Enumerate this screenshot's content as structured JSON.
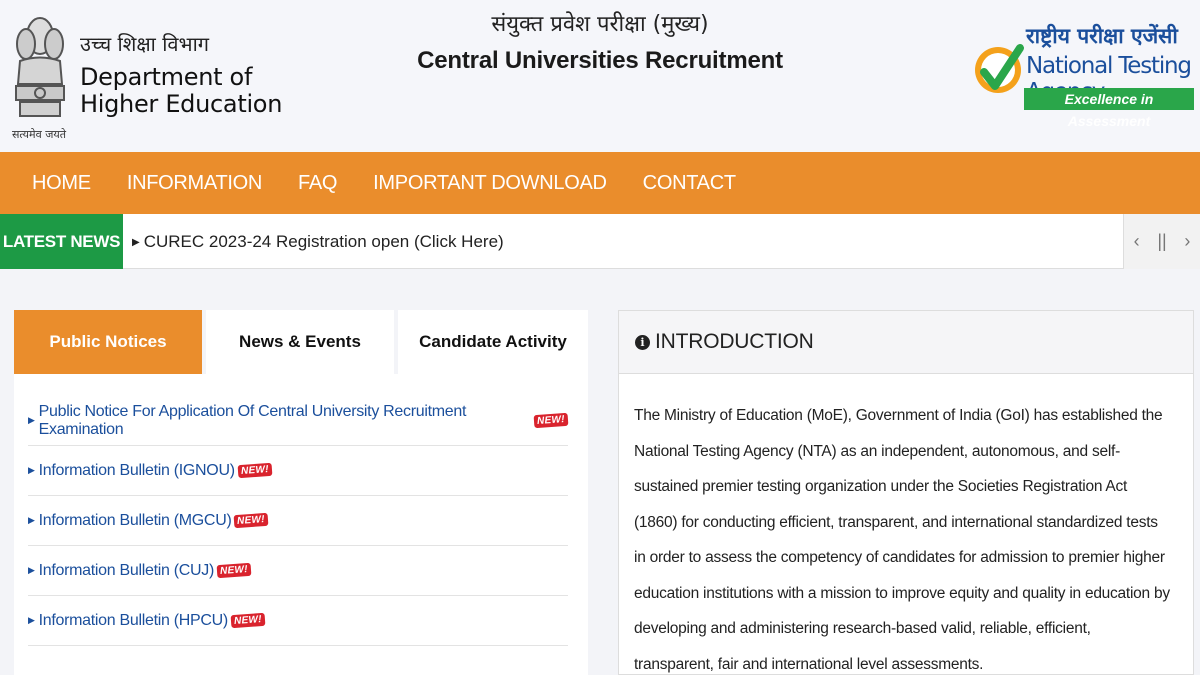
{
  "header": {
    "emblem_motto": "सत्यमेव जयते",
    "dept_hindi": "उच्च शिक्षा विभाग",
    "dept_english": "Department of Higher Education",
    "exam_hindi": "संयुक्त प्रवेश परीक्षा (मुख्य)",
    "exam_english": "Central Universities Recruitment",
    "nta_hindi": "राष्ट्रीय परीक्षा एजेंसी",
    "nta_english": "National Testing Agency",
    "nta_tagline": "Excellence in Assessment"
  },
  "nav": {
    "items": [
      {
        "label": "HOME"
      },
      {
        "label": "INFORMATION"
      },
      {
        "label": "FAQ"
      },
      {
        "label": "IMPORTANT DOWNLOAD"
      },
      {
        "label": "CONTACT"
      }
    ]
  },
  "news": {
    "label": "LATEST NEWS",
    "text": "CUREC 2023-24 Registration open (Click Here)",
    "controls": [
      "‹",
      "||",
      "›"
    ]
  },
  "tabs": [
    {
      "label": "Public Notices",
      "active": true
    },
    {
      "label": "News & Events",
      "active": false
    },
    {
      "label": "Candidate Activity",
      "active": false
    }
  ],
  "notices": [
    {
      "text": "Public Notice For Application Of Central University Recruitment Examination",
      "badge": "NEW!"
    },
    {
      "text": "Information Bulletin (IGNOU)",
      "badge": "NEW!"
    },
    {
      "text": "Information Bulletin (MGCU)",
      "badge": "NEW!"
    },
    {
      "text": "Information Bulletin (CUJ)",
      "badge": "NEW!"
    },
    {
      "text": "Information Bulletin (HPCU)",
      "badge": "NEW!"
    }
  ],
  "intro": {
    "title": "INTRODUCTION",
    "body": "The Ministry of Education (MoE), Government of India (GoI) has established the National Testing Agency (NTA) as an independent, autonomous, and self-sustained premier testing organization under the Societies Registration Act (1860) for conducting efficient, transparent, and international standardized tests in order to assess the competency of candidates for admission to premier higher education institutions with a mission to improve equity and quality in education by developing and administering research-based valid, reliable, efficient, transparent, fair and international level assessments."
  },
  "colors": {
    "nav_orange": "#ea8d2c",
    "news_green": "#1d9a45",
    "link_blue": "#1b4f9c",
    "badge_red": "#d9232d"
  }
}
